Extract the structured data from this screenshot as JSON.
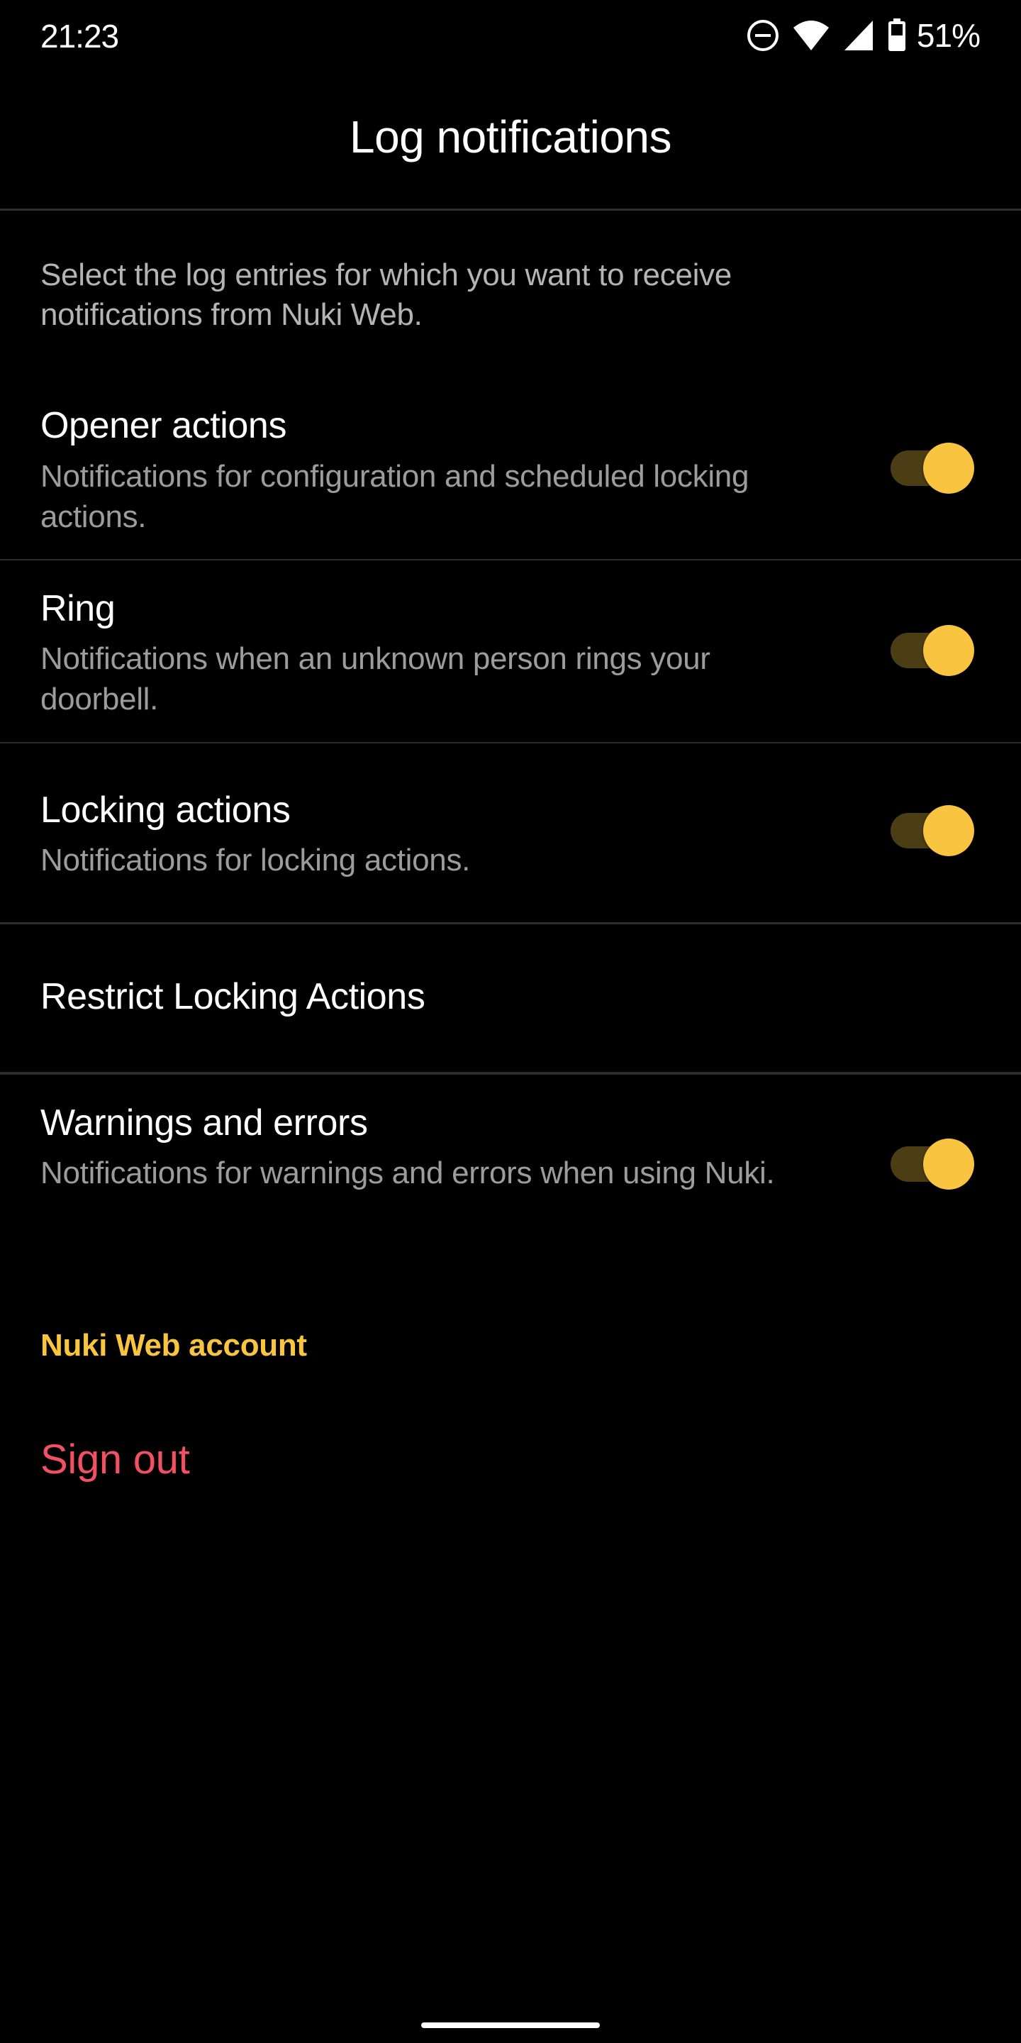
{
  "status_bar": {
    "time": "21:23",
    "icons": [
      "do-not-disturb-icon",
      "wifi-icon",
      "cellular-signal-icon",
      "battery-icon"
    ],
    "battery_percent": "51%"
  },
  "app_bar": {
    "title": "Log notifications"
  },
  "intro_text": "Select the log entries for which you want to receive notifications from Nuki Web.",
  "settings": [
    {
      "title": "Opener actions",
      "subtitle": "Notifications for configuration and scheduled locking actions.",
      "has_toggle": true,
      "enabled": true
    },
    {
      "title": "Ring",
      "subtitle": "Notifications when an unknown person rings your doorbell.",
      "has_toggle": true,
      "enabled": true
    },
    {
      "title": "Locking actions",
      "subtitle": "Notifications for locking actions.",
      "has_toggle": true,
      "enabled": true
    },
    {
      "title": "Restrict Locking Actions",
      "subtitle": "",
      "has_toggle": false
    },
    {
      "title": "Warnings and errors",
      "subtitle": "Notifications for warnings and errors when using Nuki.",
      "has_toggle": true,
      "enabled": true
    }
  ],
  "account_section": {
    "header": "Nuki Web account",
    "sign_out_label": "Sign out"
  },
  "colors": {
    "accent": "#F9C43F",
    "toggle_track_on": "#4B3D14",
    "destructive": "#F25063",
    "background": "#000000",
    "divider": "#2C2C2C"
  }
}
